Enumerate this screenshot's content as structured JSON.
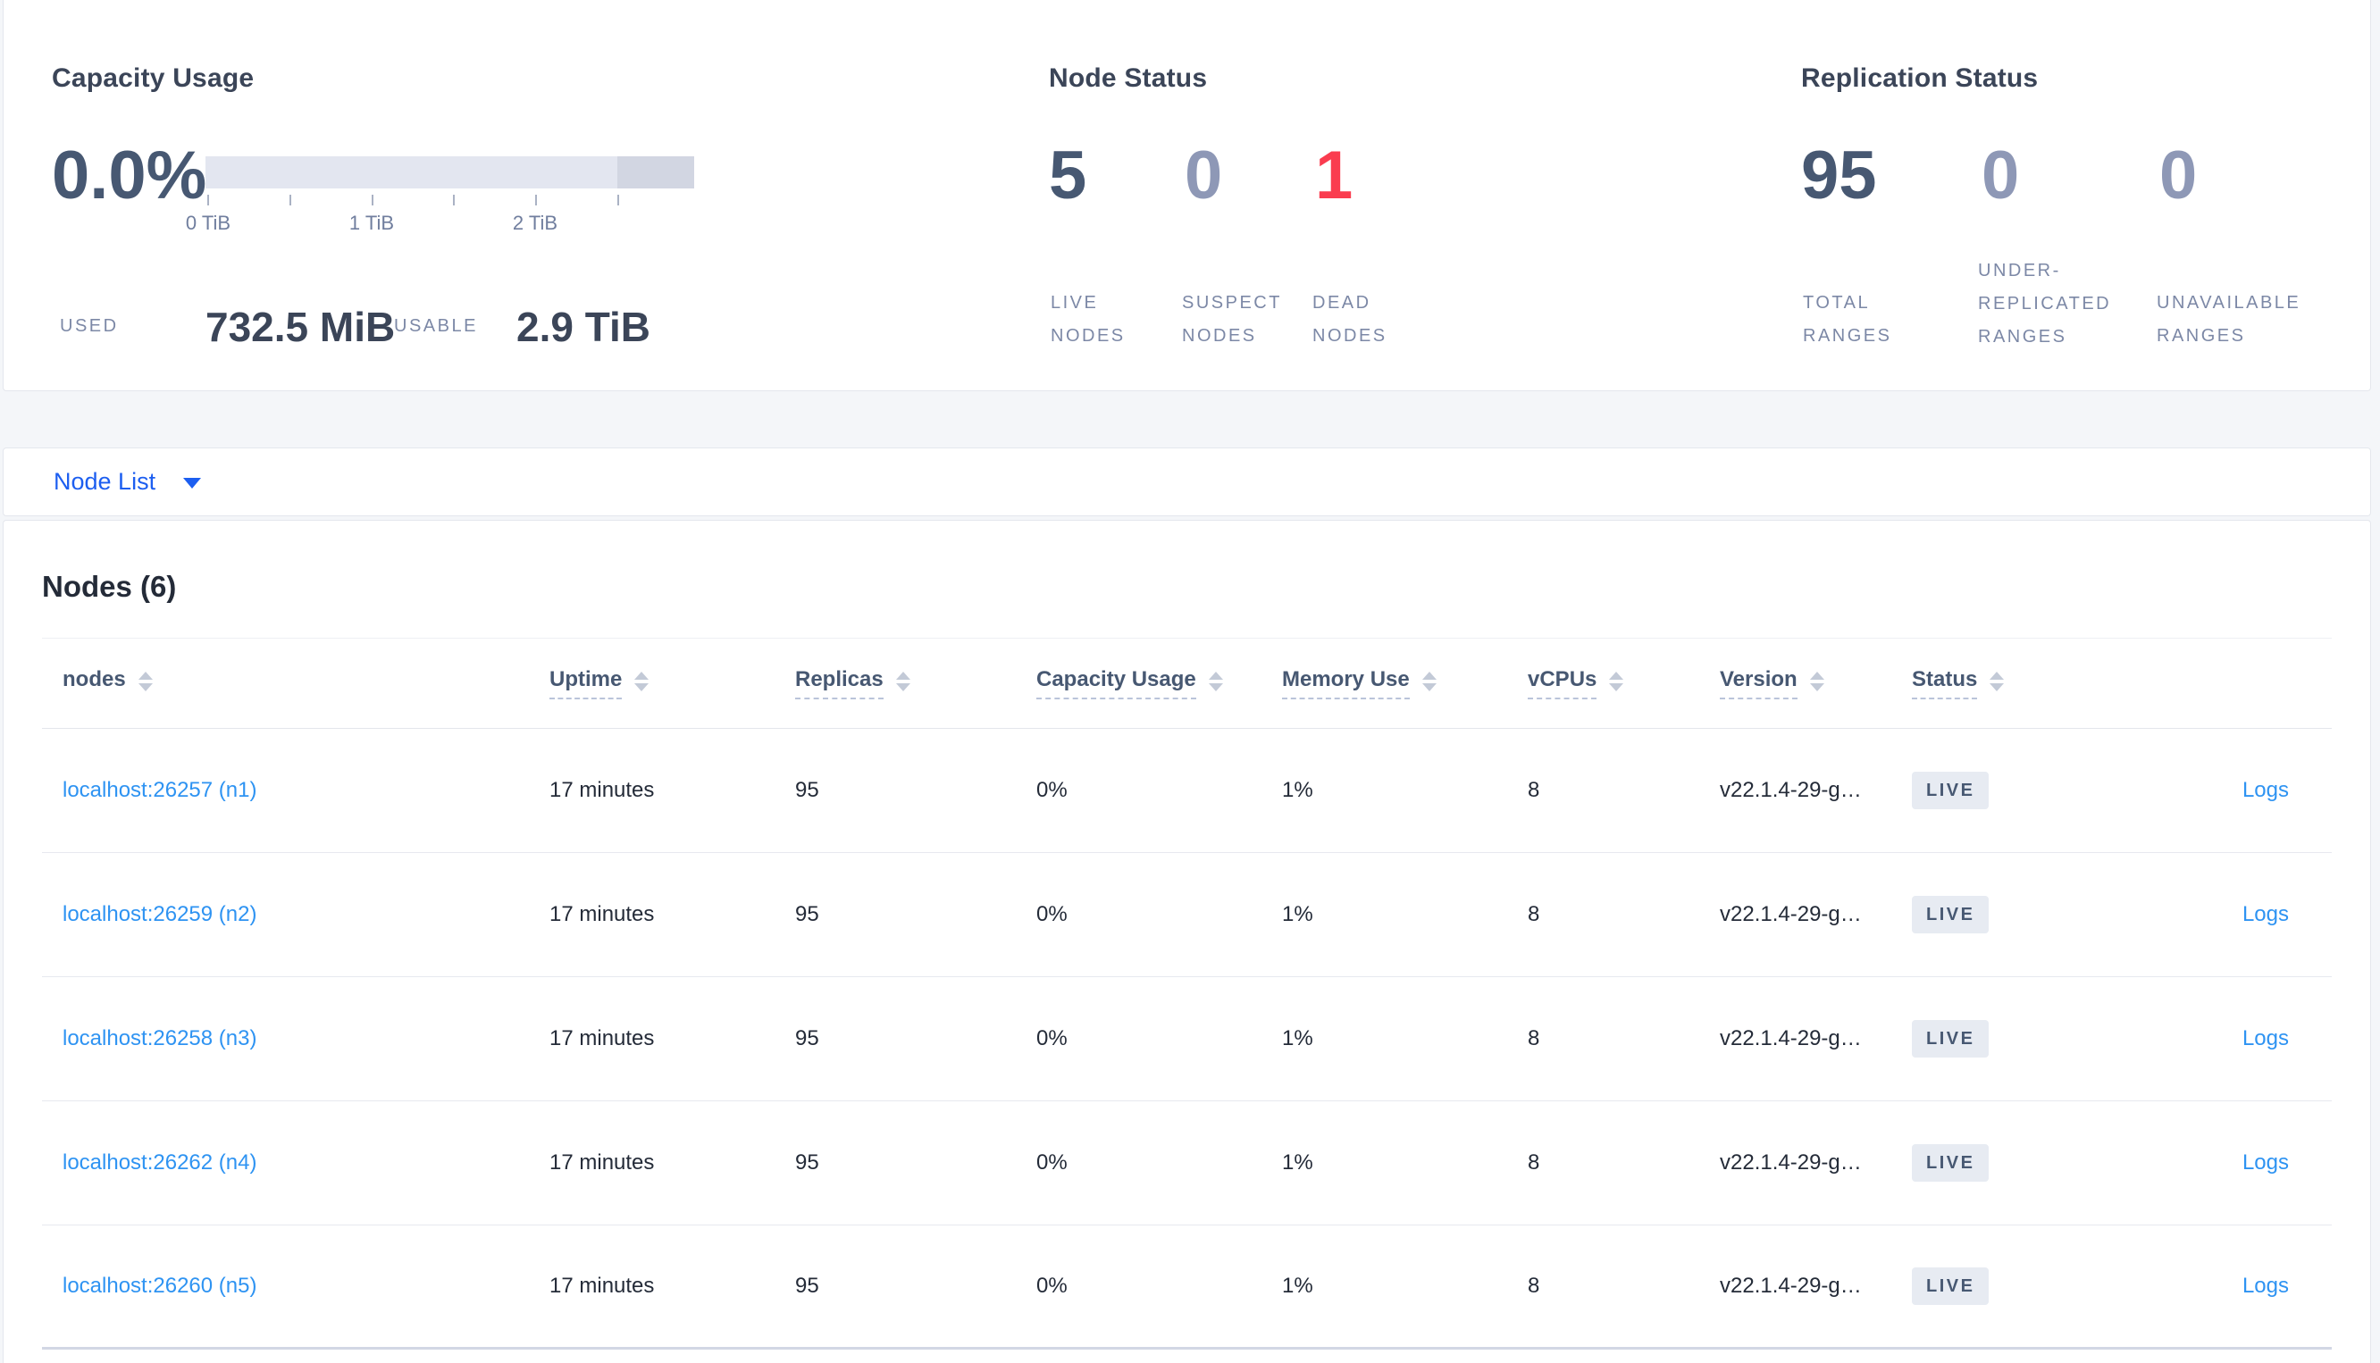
{
  "colors": {
    "accent_blue": "#1c5ef0",
    "link_blue": "#2e93f2",
    "danger_red": "#fa3c4f",
    "strong_navy": "#475872",
    "muted_blue_gray": "#8e98b6",
    "badge_bg": "#e7ebf2"
  },
  "capacity_panel": {
    "title": "Capacity Usage",
    "percent": "0.0%",
    "axis_ticks": [
      "0 TiB",
      "1 TiB",
      "2 TiB"
    ],
    "used_label": "USED",
    "used_value": "732.5 MiB",
    "usable_label": "USABLE",
    "usable_value": "2.9 TiB"
  },
  "node_status_panel": {
    "title": "Node Status",
    "stats": [
      {
        "value": "5",
        "label": "LIVE NODES"
      },
      {
        "value": "0",
        "label": "SUSPECT NODES"
      },
      {
        "value": "1",
        "label": "DEAD NODES"
      }
    ]
  },
  "replication_panel": {
    "title": "Replication Status",
    "stats": [
      {
        "value": "95",
        "label": "TOTAL RANGES"
      },
      {
        "value": "0",
        "label": "UNDER-REPLICATED RANGES"
      },
      {
        "value": "0",
        "label": "UNAVAILABLE RANGES"
      }
    ]
  },
  "node_list_bar": {
    "label": "Node List"
  },
  "nodes_section": {
    "title": "Nodes (6)",
    "columns": [
      {
        "label": "nodes",
        "tooltip": false
      },
      {
        "label": "Uptime",
        "tooltip": true
      },
      {
        "label": "Replicas",
        "tooltip": true
      },
      {
        "label": "Capacity Usage",
        "tooltip": true
      },
      {
        "label": "Memory Use",
        "tooltip": true
      },
      {
        "label": "vCPUs",
        "tooltip": true
      },
      {
        "label": "Version",
        "tooltip": true
      },
      {
        "label": "Status",
        "tooltip": true
      }
    ],
    "rows": [
      {
        "node": "localhost:26257 (n1)",
        "uptime": "17 minutes",
        "replicas": "95",
        "capacity": "0%",
        "memory": "1%",
        "vcpus": "8",
        "version": "v22.1.4-29-g…",
        "status": "LIVE",
        "logs": "Logs"
      },
      {
        "node": "localhost:26259 (n2)",
        "uptime": "17 minutes",
        "replicas": "95",
        "capacity": "0%",
        "memory": "1%",
        "vcpus": "8",
        "version": "v22.1.4-29-g…",
        "status": "LIVE",
        "logs": "Logs"
      },
      {
        "node": "localhost:26258 (n3)",
        "uptime": "17 minutes",
        "replicas": "95",
        "capacity": "0%",
        "memory": "1%",
        "vcpus": "8",
        "version": "v22.1.4-29-g…",
        "status": "LIVE",
        "logs": "Logs"
      },
      {
        "node": "localhost:26262 (n4)",
        "uptime": "17 minutes",
        "replicas": "95",
        "capacity": "0%",
        "memory": "1%",
        "vcpus": "8",
        "version": "v22.1.4-29-g…",
        "status": "LIVE",
        "logs": "Logs"
      },
      {
        "node": "localhost:26260 (n5)",
        "uptime": "17 minutes",
        "replicas": "95",
        "capacity": "0%",
        "memory": "1%",
        "vcpus": "8",
        "version": "v22.1.4-29-g…",
        "status": "LIVE",
        "logs": "Logs"
      }
    ]
  }
}
